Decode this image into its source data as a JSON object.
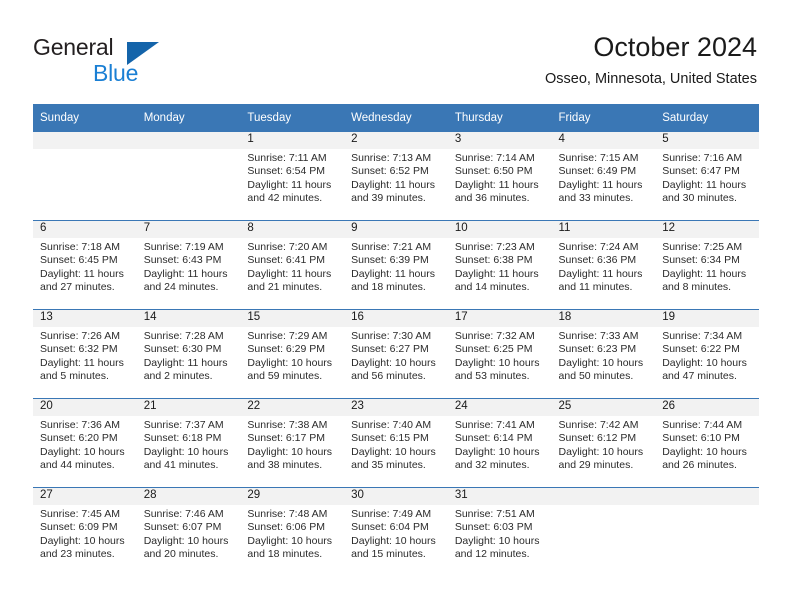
{
  "brand": {
    "name_top": "General",
    "name_bottom": "Blue",
    "accent_color": "#1a7fd4",
    "triangle_color": "#1464aa"
  },
  "header": {
    "title": "October 2024",
    "subtitle": "Osseo, Minnesota, United States"
  },
  "calendar": {
    "header_bg": "#3a77b5",
    "daynum_bg": "#f2f2f2",
    "weekdays": [
      "Sunday",
      "Monday",
      "Tuesday",
      "Wednesday",
      "Thursday",
      "Friday",
      "Saturday"
    ],
    "weeks": [
      [
        {
          "day": "",
          "empty": true
        },
        {
          "day": "",
          "empty": true
        },
        {
          "day": "1",
          "sunrise": "Sunrise: 7:11 AM",
          "sunset": "Sunset: 6:54 PM",
          "daylight_1": "Daylight: 11 hours",
          "daylight_2": "and 42 minutes."
        },
        {
          "day": "2",
          "sunrise": "Sunrise: 7:13 AM",
          "sunset": "Sunset: 6:52 PM",
          "daylight_1": "Daylight: 11 hours",
          "daylight_2": "and 39 minutes."
        },
        {
          "day": "3",
          "sunrise": "Sunrise: 7:14 AM",
          "sunset": "Sunset: 6:50 PM",
          "daylight_1": "Daylight: 11 hours",
          "daylight_2": "and 36 minutes."
        },
        {
          "day": "4",
          "sunrise": "Sunrise: 7:15 AM",
          "sunset": "Sunset: 6:49 PM",
          "daylight_1": "Daylight: 11 hours",
          "daylight_2": "and 33 minutes."
        },
        {
          "day": "5",
          "sunrise": "Sunrise: 7:16 AM",
          "sunset": "Sunset: 6:47 PM",
          "daylight_1": "Daylight: 11 hours",
          "daylight_2": "and 30 minutes."
        }
      ],
      [
        {
          "day": "6",
          "sunrise": "Sunrise: 7:18 AM",
          "sunset": "Sunset: 6:45 PM",
          "daylight_1": "Daylight: 11 hours",
          "daylight_2": "and 27 minutes."
        },
        {
          "day": "7",
          "sunrise": "Sunrise: 7:19 AM",
          "sunset": "Sunset: 6:43 PM",
          "daylight_1": "Daylight: 11 hours",
          "daylight_2": "and 24 minutes."
        },
        {
          "day": "8",
          "sunrise": "Sunrise: 7:20 AM",
          "sunset": "Sunset: 6:41 PM",
          "daylight_1": "Daylight: 11 hours",
          "daylight_2": "and 21 minutes."
        },
        {
          "day": "9",
          "sunrise": "Sunrise: 7:21 AM",
          "sunset": "Sunset: 6:39 PM",
          "daylight_1": "Daylight: 11 hours",
          "daylight_2": "and 18 minutes."
        },
        {
          "day": "10",
          "sunrise": "Sunrise: 7:23 AM",
          "sunset": "Sunset: 6:38 PM",
          "daylight_1": "Daylight: 11 hours",
          "daylight_2": "and 14 minutes."
        },
        {
          "day": "11",
          "sunrise": "Sunrise: 7:24 AM",
          "sunset": "Sunset: 6:36 PM",
          "daylight_1": "Daylight: 11 hours",
          "daylight_2": "and 11 minutes."
        },
        {
          "day": "12",
          "sunrise": "Sunrise: 7:25 AM",
          "sunset": "Sunset: 6:34 PM",
          "daylight_1": "Daylight: 11 hours",
          "daylight_2": "and 8 minutes."
        }
      ],
      [
        {
          "day": "13",
          "sunrise": "Sunrise: 7:26 AM",
          "sunset": "Sunset: 6:32 PM",
          "daylight_1": "Daylight: 11 hours",
          "daylight_2": "and 5 minutes."
        },
        {
          "day": "14",
          "sunrise": "Sunrise: 7:28 AM",
          "sunset": "Sunset: 6:30 PM",
          "daylight_1": "Daylight: 11 hours",
          "daylight_2": "and 2 minutes."
        },
        {
          "day": "15",
          "sunrise": "Sunrise: 7:29 AM",
          "sunset": "Sunset: 6:29 PM",
          "daylight_1": "Daylight: 10 hours",
          "daylight_2": "and 59 minutes."
        },
        {
          "day": "16",
          "sunrise": "Sunrise: 7:30 AM",
          "sunset": "Sunset: 6:27 PM",
          "daylight_1": "Daylight: 10 hours",
          "daylight_2": "and 56 minutes."
        },
        {
          "day": "17",
          "sunrise": "Sunrise: 7:32 AM",
          "sunset": "Sunset: 6:25 PM",
          "daylight_1": "Daylight: 10 hours",
          "daylight_2": "and 53 minutes."
        },
        {
          "day": "18",
          "sunrise": "Sunrise: 7:33 AM",
          "sunset": "Sunset: 6:23 PM",
          "daylight_1": "Daylight: 10 hours",
          "daylight_2": "and 50 minutes."
        },
        {
          "day": "19",
          "sunrise": "Sunrise: 7:34 AM",
          "sunset": "Sunset: 6:22 PM",
          "daylight_1": "Daylight: 10 hours",
          "daylight_2": "and 47 minutes."
        }
      ],
      [
        {
          "day": "20",
          "sunrise": "Sunrise: 7:36 AM",
          "sunset": "Sunset: 6:20 PM",
          "daylight_1": "Daylight: 10 hours",
          "daylight_2": "and 44 minutes."
        },
        {
          "day": "21",
          "sunrise": "Sunrise: 7:37 AM",
          "sunset": "Sunset: 6:18 PM",
          "daylight_1": "Daylight: 10 hours",
          "daylight_2": "and 41 minutes."
        },
        {
          "day": "22",
          "sunrise": "Sunrise: 7:38 AM",
          "sunset": "Sunset: 6:17 PM",
          "daylight_1": "Daylight: 10 hours",
          "daylight_2": "and 38 minutes."
        },
        {
          "day": "23",
          "sunrise": "Sunrise: 7:40 AM",
          "sunset": "Sunset: 6:15 PM",
          "daylight_1": "Daylight: 10 hours",
          "daylight_2": "and 35 minutes."
        },
        {
          "day": "24",
          "sunrise": "Sunrise: 7:41 AM",
          "sunset": "Sunset: 6:14 PM",
          "daylight_1": "Daylight: 10 hours",
          "daylight_2": "and 32 minutes."
        },
        {
          "day": "25",
          "sunrise": "Sunrise: 7:42 AM",
          "sunset": "Sunset: 6:12 PM",
          "daylight_1": "Daylight: 10 hours",
          "daylight_2": "and 29 minutes."
        },
        {
          "day": "26",
          "sunrise": "Sunrise: 7:44 AM",
          "sunset": "Sunset: 6:10 PM",
          "daylight_1": "Daylight: 10 hours",
          "daylight_2": "and 26 minutes."
        }
      ],
      [
        {
          "day": "27",
          "sunrise": "Sunrise: 7:45 AM",
          "sunset": "Sunset: 6:09 PM",
          "daylight_1": "Daylight: 10 hours",
          "daylight_2": "and 23 minutes."
        },
        {
          "day": "28",
          "sunrise": "Sunrise: 7:46 AM",
          "sunset": "Sunset: 6:07 PM",
          "daylight_1": "Daylight: 10 hours",
          "daylight_2": "and 20 minutes."
        },
        {
          "day": "29",
          "sunrise": "Sunrise: 7:48 AM",
          "sunset": "Sunset: 6:06 PM",
          "daylight_1": "Daylight: 10 hours",
          "daylight_2": "and 18 minutes."
        },
        {
          "day": "30",
          "sunrise": "Sunrise: 7:49 AM",
          "sunset": "Sunset: 6:04 PM",
          "daylight_1": "Daylight: 10 hours",
          "daylight_2": "and 15 minutes."
        },
        {
          "day": "31",
          "sunrise": "Sunrise: 7:51 AM",
          "sunset": "Sunset: 6:03 PM",
          "daylight_1": "Daylight: 10 hours",
          "daylight_2": "and 12 minutes."
        },
        {
          "day": "",
          "empty": true
        },
        {
          "day": "",
          "empty": true
        }
      ]
    ]
  }
}
